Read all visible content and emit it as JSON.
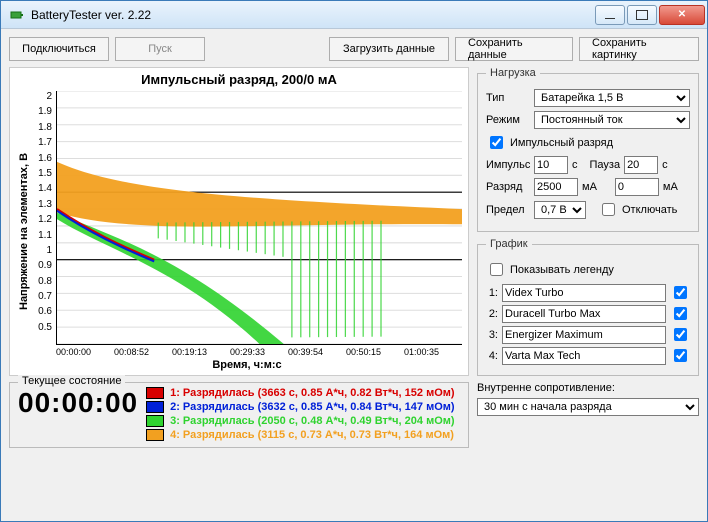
{
  "window": {
    "title": "BatteryTester ver. 2.22"
  },
  "toolbar": {
    "connect": "Подключиться",
    "start": "Пуск",
    "load": "Загрузить данные",
    "save_data": "Сохранить данные",
    "save_image": "Сохранить картинку"
  },
  "chart_data": {
    "type": "line",
    "title": "Импульсный разряд, 200/0 мА",
    "xlabel": "Время, ч:м:с",
    "ylabel": "Напряжение на элементах, В",
    "ylim": [
      0.5,
      2.0
    ],
    "yticks": [
      "2",
      "1.9",
      "1.8",
      "1.7",
      "1.6",
      "1.5",
      "1.4",
      "1.3",
      "1.2",
      "1.1",
      "1",
      "0.9",
      "0.8",
      "0.7",
      "0.6",
      "0.5"
    ],
    "xticks": [
      "00:00:00",
      "00:08:52",
      "00:19:13",
      "00:29:33",
      "00:39:54",
      "00:50:15",
      "01:00:35",
      ""
    ],
    "series": [
      {
        "name": "Videx Turbo",
        "color": "#d80000",
        "time_s": 3663,
        "Ah": 0.85,
        "Wh": 0.82,
        "mOhm": 152
      },
      {
        "name": "Duracell Turbo Max",
        "color": "#0020d8",
        "time_s": 3632,
        "Ah": 0.85,
        "Wh": 0.84,
        "mOhm": 147
      },
      {
        "name": "Energizer Maximum",
        "color": "#2fd32f",
        "time_s": 2050,
        "Ah": 0.48,
        "Wh": 0.49,
        "mOhm": 204
      },
      {
        "name": "Varta Max Tech",
        "color": "#f2a020",
        "time_s": 3115,
        "Ah": 0.73,
        "Wh": 0.73,
        "mOhm": 164
      }
    ],
    "envelope_upper": [
      [
        0,
        1.58
      ],
      [
        0.5,
        1.44
      ],
      [
        1.0,
        1.32
      ]
    ],
    "envelope_lower_green": [
      [
        0,
        1.3
      ],
      [
        0.3,
        1.05
      ],
      [
        0.55,
        0.5
      ]
    ],
    "envelope_lower_orange": [
      [
        0,
        1.3
      ],
      [
        0.5,
        1.25
      ],
      [
        1.0,
        1.22
      ]
    ]
  },
  "load": {
    "legend": "Нагрузка",
    "type_label": "Тип",
    "type_value": "Батарейка 1,5 В",
    "mode_label": "Режим",
    "mode_value": "Постоянный ток",
    "pulse_check": "Импульсный разряд",
    "pulse_checked": true,
    "pulse_label": "Импульс",
    "pulse_value": "10",
    "sec1": "с",
    "pause_label": "Пауза",
    "pause_value": "20",
    "sec2": "с",
    "discharge_label": "Разряд",
    "discharge_value": "2500",
    "ma1": "мА",
    "discharge2_value": "0",
    "ma2": "мА",
    "limit_label": "Предел",
    "limit_value": "0,7 В",
    "disconnect_label": "Отключать",
    "disconnect_checked": false
  },
  "graph": {
    "legend": "График",
    "show_legend_label": "Показывать легенду",
    "show_legend_checked": false,
    "series": [
      {
        "n": "1:",
        "name": "Videx Turbo",
        "checked": true
      },
      {
        "n": "2:",
        "name": "Duracell Turbo Max",
        "checked": true
      },
      {
        "n": "3:",
        "name": "Energizer Maximum",
        "checked": true
      },
      {
        "n": "4:",
        "name": "Varta Max Tech",
        "checked": true
      }
    ]
  },
  "status": {
    "legend": "Текущее состояние",
    "timer": "00:00:00",
    "lines": [
      {
        "color": "#d80000",
        "text": "1: Разрядилась (3663 с, 0.85 А*ч, 0.82 Вт*ч, 152 мОм)"
      },
      {
        "color": "#0020d8",
        "text": "2: Разрядилась (3632 с, 0.85 А*ч, 0.84 Вт*ч, 147 мОм)"
      },
      {
        "color": "#2fd32f",
        "text": "3: Разрядилась (2050 с, 0.48 А*ч, 0.49 Вт*ч, 204 мОм)"
      },
      {
        "color": "#f2a020",
        "text": "4: Разрядилась (3115 с, 0.73 А*ч, 0.73 Вт*ч, 164 мОм)"
      }
    ]
  },
  "resistance": {
    "label": "Внутренне сопротивление:",
    "value": "30 мин с начала разряда"
  }
}
